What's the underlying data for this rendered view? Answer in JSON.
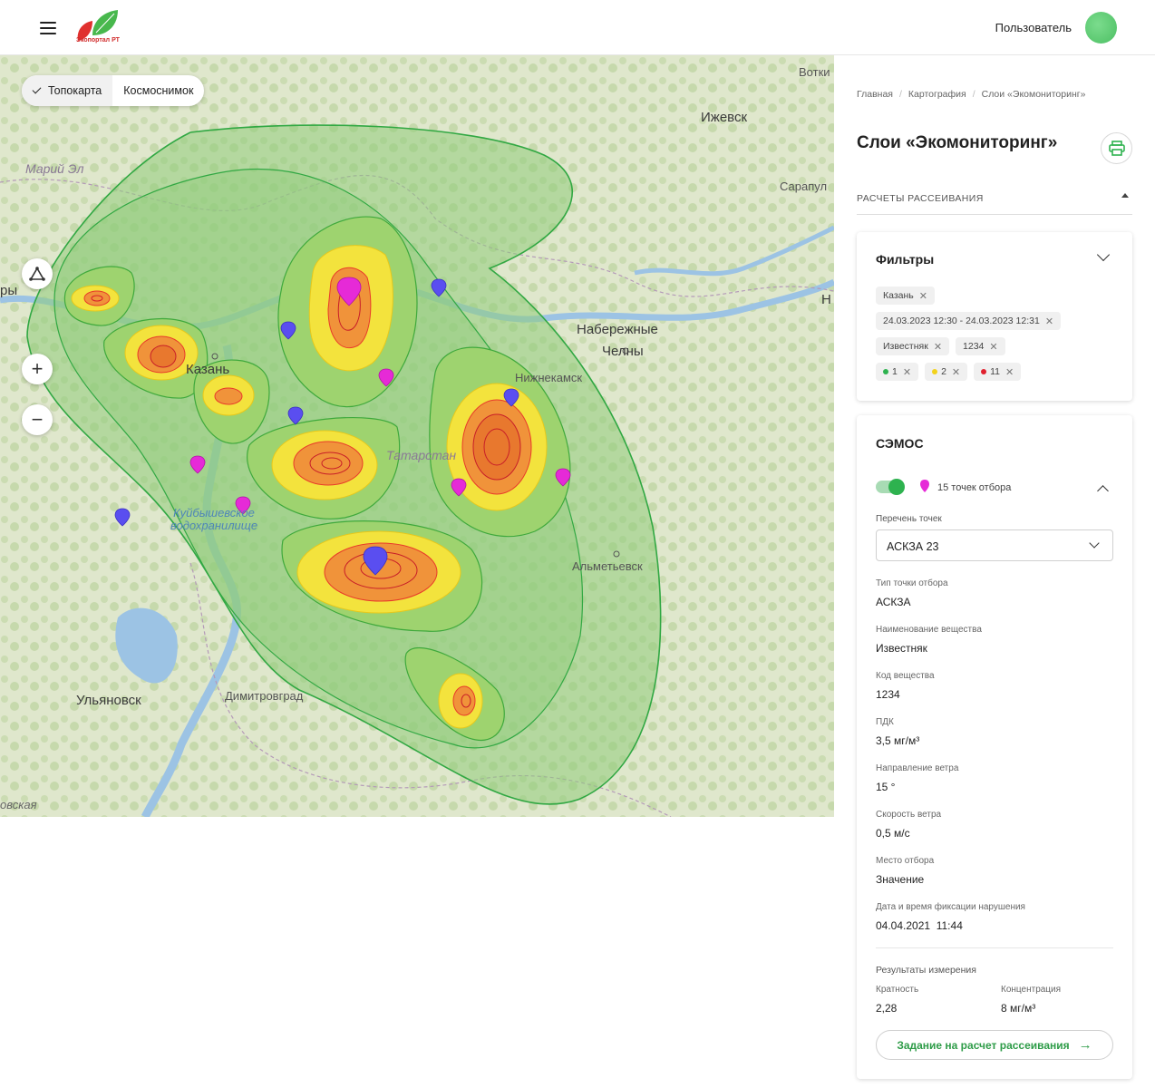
{
  "header": {
    "logo_text": "Экопортал РТ",
    "user_name": "Пользователь"
  },
  "map": {
    "layers": [
      {
        "label": "Топокарта",
        "active": true
      },
      {
        "label": "Космоснимок",
        "active": false
      }
    ],
    "labels": {
      "izhevsk": "Ижевск",
      "votkinsk": "Вотки",
      "sarapul": "Сарапул",
      "mari_el": "Марий Эл",
      "kazan": "Казань",
      "naberezhnye": "Набережные",
      "chelny": "Челны",
      "nizhnekamsk": "Нижнекамск",
      "tatarstan": "Татарстан",
      "almetyevsk": "Альметьевск",
      "ulyanovsk": "Ульяновск",
      "dimitrovgrad": "Димитровград",
      "kuibyshev1": "Куйбышевское",
      "kuibyshev2": "водохранилище",
      "edge_left": "ры",
      "edge_right": "Н",
      "edge_bottom": "овская"
    }
  },
  "panel": {
    "breadcrumbs": [
      "Главная",
      "Картография",
      "Слои «Экомониторинг»"
    ],
    "title": "Слои «Экомониторинг»",
    "section": "РАСЧЕТЫ РАССЕИВАНИЯ",
    "filters": {
      "title": "Фильтры",
      "chips": {
        "city": "Казань",
        "dates": "24.03.2023 12:30 - 24.03.2023 12:31",
        "substance": "Известняк",
        "code": "1234",
        "level1": "1",
        "level2": "2",
        "level3": "11"
      },
      "colors": {
        "green": "#2eb24f",
        "yellow": "#f2d21b",
        "red": "#e0202e"
      }
    },
    "semos": {
      "title": "СЭМОС",
      "points_label": "15 точек отбора",
      "list_label": "Перечень точек",
      "list_value": "АСКЗА 23",
      "fields": {
        "type_label": "Тип точки отбора",
        "type_value": "АСКЗА",
        "substance_label": "Наименование вещества",
        "substance_value": "Известняк",
        "code_label": "Код вещества",
        "code_value": "1234",
        "pdk_label": "ПДК",
        "pdk_value": "3,5 мг/м³",
        "wind_dir_label": "Направление ветра",
        "wind_dir_value": "15 °",
        "wind_speed_label": "Скорость ветра",
        "wind_speed_value": "0,5 м/с",
        "place_label": "Место отбора",
        "place_value": "Значение",
        "datetime_label": "Дата и время фиксации нарушения",
        "datetime_value": "04.04.2021  11:44"
      },
      "results": {
        "title": "Результаты измерения",
        "ratio_label": "Кратность",
        "ratio_value": "2,28",
        "conc_label": "Концентрация",
        "conc_value": "8 мг/м³"
      },
      "action_label": "Задание на расчет рассеивания"
    }
  }
}
